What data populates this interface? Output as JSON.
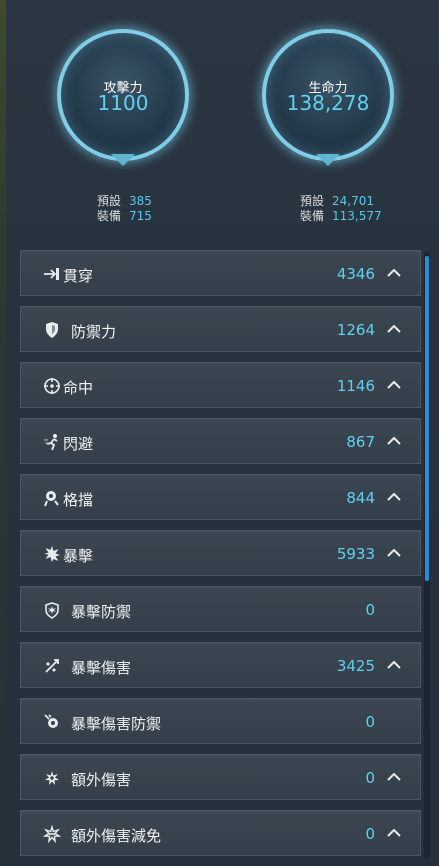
{
  "orbs": {
    "attack": {
      "label": "攻擊力",
      "value": "1100",
      "preset_key": "預設",
      "preset_val": "385",
      "equip_key": "裝備",
      "equip_val": "715"
    },
    "hp": {
      "label": "生命力",
      "value": "138,278",
      "preset_key": "預設",
      "preset_val": "24,701",
      "equip_key": "裝備",
      "equip_val": "113,577"
    }
  },
  "stats": [
    {
      "name": "貫穿",
      "value": "4346",
      "icon": "pierce-icon",
      "expand": true
    },
    {
      "name": "防禦力",
      "value": "1264",
      "icon": "shield-icon",
      "expand": true
    },
    {
      "name": "命中",
      "value": "1146",
      "icon": "crosshair-icon",
      "expand": true
    },
    {
      "name": "閃避",
      "value": "867",
      "icon": "dodge-icon",
      "expand": true
    },
    {
      "name": "格擋",
      "value": "844",
      "icon": "block-icon",
      "expand": true
    },
    {
      "name": "暴擊",
      "value": "5933",
      "icon": "critical-icon",
      "expand": true
    },
    {
      "name": "暴擊防禦",
      "value": "0",
      "icon": "critical-defense-icon",
      "expand": false
    },
    {
      "name": "暴擊傷害",
      "value": "3425",
      "icon": "critical-damage-icon",
      "expand": true
    },
    {
      "name": "暴擊傷害防禦",
      "value": "0",
      "icon": "critical-damage-defense-icon",
      "expand": false
    },
    {
      "name": "額外傷害",
      "value": "0",
      "icon": "extra-damage-icon",
      "expand": true
    },
    {
      "name": "額外傷害減免",
      "value": "0",
      "icon": "extra-damage-reduction-icon",
      "expand": true
    }
  ],
  "colors": {
    "accent": "#5fd0f0",
    "row_bg": "#38434e",
    "scroll": "#2c8bd4"
  }
}
